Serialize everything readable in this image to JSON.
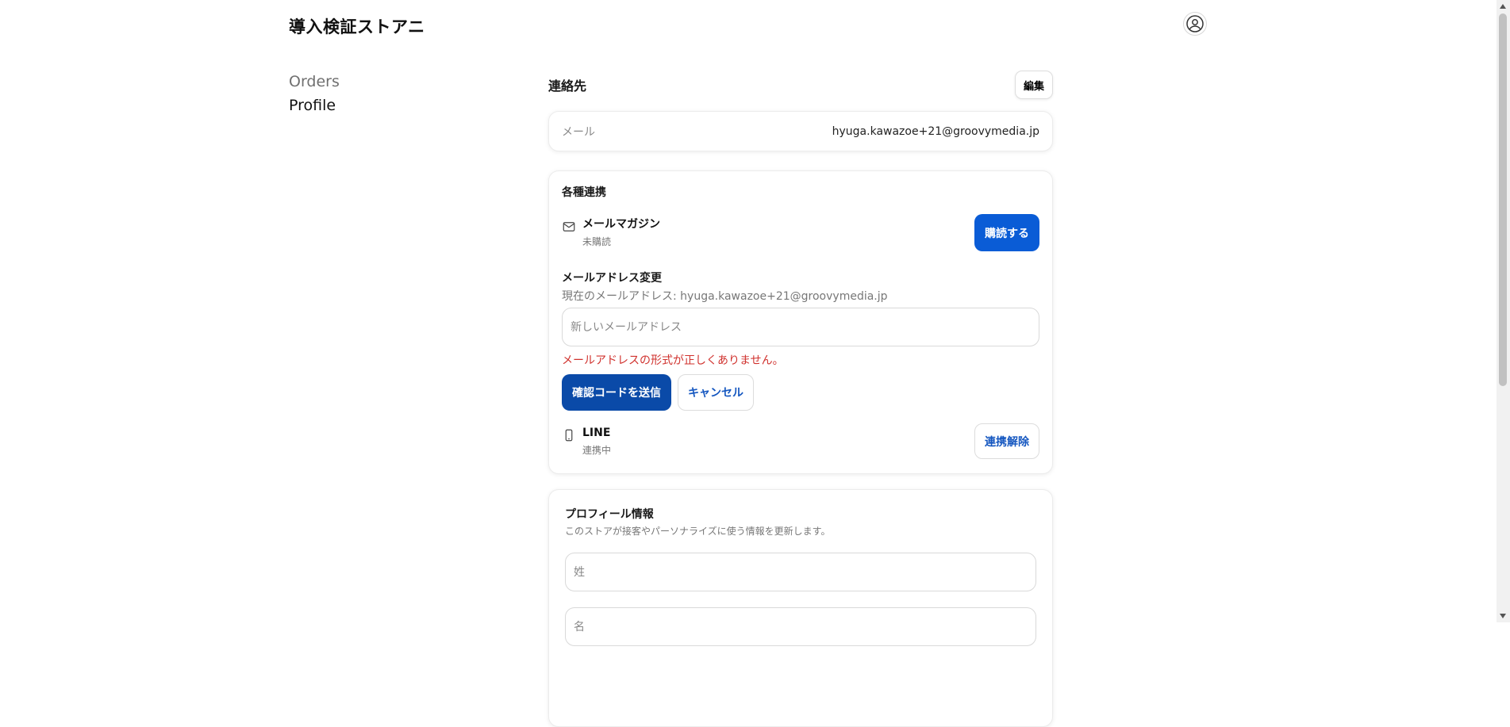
{
  "header": {
    "store_name": "導入検証ストアニ",
    "account_icon": "account-circle-icon"
  },
  "nav": {
    "items": [
      {
        "label": "Orders"
      },
      {
        "label": "Profile"
      }
    ]
  },
  "contact": {
    "title": "連絡先",
    "edit_label": "編集",
    "email_label": "メール",
    "email_value": "hyuga.kawazoe+21@groovymedia.jp"
  },
  "links": {
    "title": "各種連携",
    "newsletter": {
      "icon": "mail-icon",
      "title": "メールマガジン",
      "status": "未購読",
      "button_label": "購読する"
    },
    "email_change": {
      "title": "メールアドレス変更",
      "current": "現在のメールアドレス: hyuga.kawazoe+21@groovymedia.jp",
      "input_placeholder": "新しいメールアドレス",
      "error": "メールアドレスの形式が正しくありません。",
      "send_label": "確認コードを送信",
      "cancel_label": "キャンセル"
    },
    "line": {
      "icon": "smartphone-icon",
      "title": "LINE",
      "status": "連携中",
      "button_label": "連携解除"
    }
  },
  "profile": {
    "title": "プロフィール情報",
    "description": "このストアが接客やパーソナライズに使う情報を更新します。",
    "last_name_placeholder": "姓",
    "first_name_placeholder": "名"
  },
  "colors": {
    "primary": "#0a5cd6",
    "primary_dark": "#0a4aa8",
    "error": "#d0312d",
    "link": "#1557c0"
  }
}
